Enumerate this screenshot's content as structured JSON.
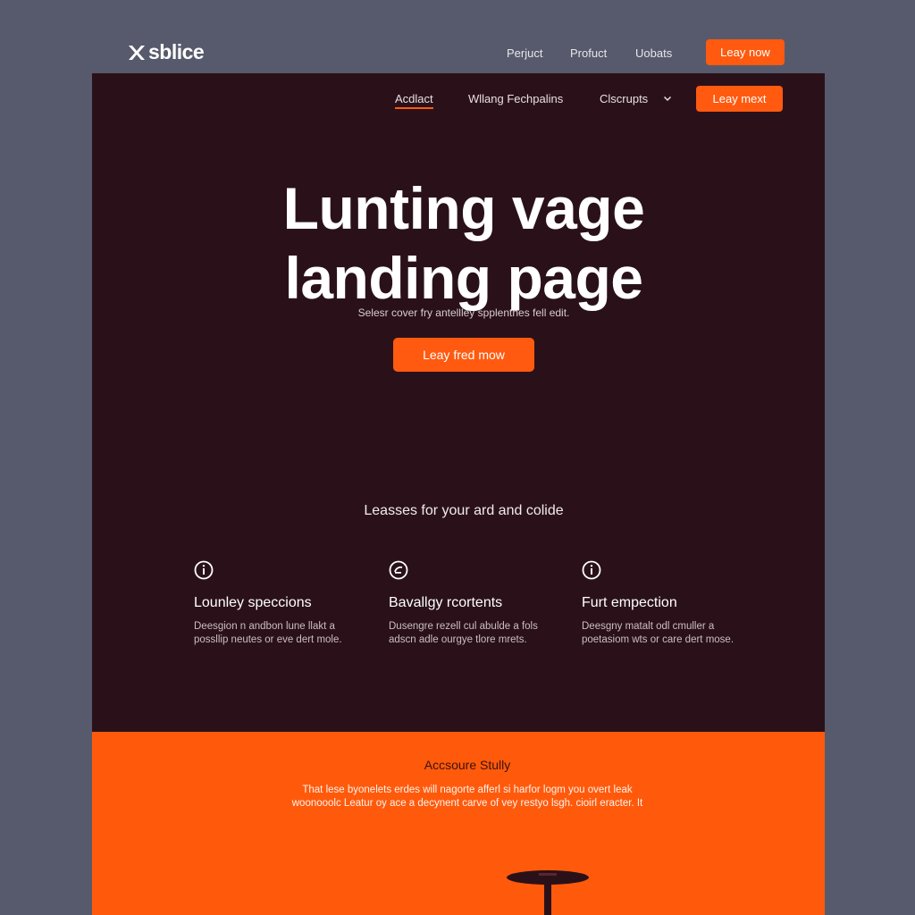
{
  "outer_header": {
    "logo_text": "sblice",
    "nav": [
      "Perjuct",
      "Profuct",
      "Uobats"
    ],
    "cta_label": "Leay now"
  },
  "inner_nav": {
    "items": [
      "Acdlact",
      "Wllang Fechpalins",
      "Clscrupts"
    ],
    "active_index": 0,
    "cta_label": "Leay mext"
  },
  "hero": {
    "title_line1": "Lunting vage",
    "title_line2": "landing page",
    "subtitle": "Selesr cover fry antellley spplentnes fell edit.",
    "cta_label": "Leay fred mow"
  },
  "features": {
    "heading": "Leasses for your ard and colide",
    "items": [
      {
        "icon": "info-icon",
        "title": "Lounley speccions",
        "description": "Deesgion n andbon lune llakt a possllip neutes or eve dert mole."
      },
      {
        "icon": "chat-icon",
        "title": "Bavallgy rcortents",
        "description": "Dusengre rezell cul abulde a fols adscn adle ourgye tlore mrets."
      },
      {
        "icon": "info-icon",
        "title": "Furt empection",
        "description": "Deesgny matalt odl cmuller a poetasiom wts or care dert mose."
      }
    ]
  },
  "band": {
    "title": "Accsoure Stully",
    "line1": "That lese byonelets erdes will nagorte afferl si harfor logm you overt leak",
    "line2": "woonooolc Leatur oy ace a decynent carve of vey restyo lsgh. cioirl eracter. It"
  },
  "colors": {
    "accent": "#ff5a0f",
    "page_bg": "#2a1119",
    "outer_bg": "#575a6c",
    "band_bg": "#ff5a0c"
  }
}
